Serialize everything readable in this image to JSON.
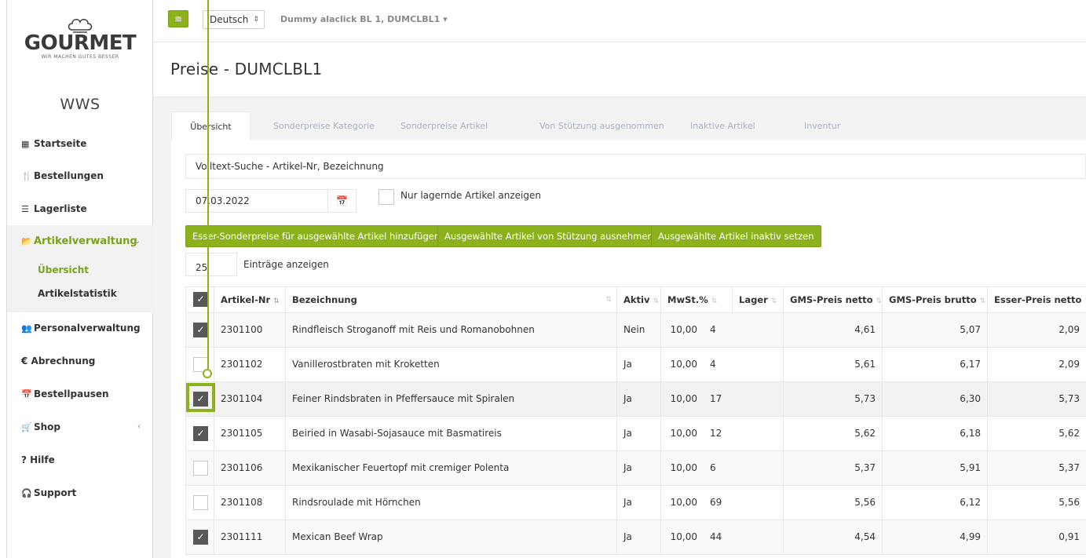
{
  "brand": {
    "logo_text": "GOURMET",
    "slogan": "WIR MACHEN GUTES BESSER",
    "app_name": "WWS"
  },
  "sidebar": {
    "items": [
      {
        "label": "Startseite",
        "icon": "th-large-icon"
      },
      {
        "label": "Bestellungen",
        "icon": "cutlery-icon"
      },
      {
        "label": "Lagerliste",
        "icon": "list-icon"
      },
      {
        "label": "Artikelverwaltung",
        "icon": "folder-open-icon"
      },
      {
        "label": "Personalverwaltung",
        "icon": "users-icon"
      },
      {
        "label": "€ Abrechnung",
        "icon": ""
      },
      {
        "label": "Bestellpausen",
        "icon": "calendar-icon"
      },
      {
        "label": "Shop",
        "icon": "cart-icon"
      },
      {
        "label": "? Hilfe",
        "icon": ""
      },
      {
        "label": "Support",
        "icon": "headset-icon"
      }
    ],
    "subitems": [
      {
        "label": "Übersicht"
      },
      {
        "label": "Artikelstatistik"
      }
    ]
  },
  "topbar": {
    "menu_icon": "≡",
    "language": "Deutsch",
    "account": "Dummy alaclick BL 1, DUMCLBL1 ▾"
  },
  "page": {
    "title": "Preise - DUMCLBL1"
  },
  "tabs": [
    {
      "label": "Übersicht"
    },
    {
      "label": "Sonderpreise Kategorie"
    },
    {
      "label": "Sonderpreise Artikel"
    },
    {
      "label": "Von Stützung ausgenommen"
    },
    {
      "label": "Inaktive Artikel"
    },
    {
      "label": "Inventur"
    }
  ],
  "filters": {
    "search_value": "Volltext-Suche - Artikel-Nr, Bezeichnung",
    "date": "07.03.2022",
    "stock_only_label": "Nur lagernde Artikel anzeigen"
  },
  "actions": {
    "add_special_prices": "Esser-Sonderpreise für ausgewählte Artikel hinzufügen",
    "exclude_subsidy": "Ausgewählte Artikel von Stützung ausnehmen",
    "set_inactive": "Ausgewählte Artikel inaktiv setzen"
  },
  "page_length": {
    "value": "25",
    "label": "Einträge anzeigen"
  },
  "table": {
    "columns": [
      "Artikel-Nr",
      "Bezeichnung",
      "Aktiv",
      "MwSt.%",
      "Lager",
      "GMS-Preis netto",
      "GMS-Preis brutto",
      "Esser-Preis netto"
    ],
    "rows": [
      {
        "checked": true,
        "nr": "2301100",
        "name": "Rindfleisch Stroganoff mit Reis und Romanobohnen",
        "aktiv": "Nein",
        "mwst": "10,00",
        "lager": "4",
        "gms_netto": "4,61",
        "gms_brutto": "5,07",
        "esser_netto": "2,09"
      },
      {
        "checked": false,
        "nr": "2301102",
        "name": "Vanillerostbraten mit Kroketten",
        "aktiv": "Ja",
        "mwst": "10,00",
        "lager": "4",
        "gms_netto": "5,61",
        "gms_brutto": "6,17",
        "esser_netto": "2,09"
      },
      {
        "checked": true,
        "nr": "2301104",
        "name": "Feiner Rindsbraten in Pfeffersauce mit Spiralen",
        "aktiv": "Ja",
        "mwst": "10,00",
        "lager": "17",
        "gms_netto": "5,73",
        "gms_brutto": "6,30",
        "esser_netto": "5,73"
      },
      {
        "checked": true,
        "nr": "2301105",
        "name": "Beiried in Wasabi-Sojasauce mit Basmatireis",
        "aktiv": "Ja",
        "mwst": "10,00",
        "lager": "12",
        "gms_netto": "5,62",
        "gms_brutto": "6,18",
        "esser_netto": "5,62"
      },
      {
        "checked": false,
        "nr": "2301106",
        "name": "Mexikanischer Feuertopf mit cremiger Polenta",
        "aktiv": "Ja",
        "mwst": "10,00",
        "lager": "6",
        "gms_netto": "5,37",
        "gms_brutto": "5,91",
        "esser_netto": "5,37"
      },
      {
        "checked": false,
        "nr": "2301108",
        "name": "Rindsroulade mit Hörnchen",
        "aktiv": "Ja",
        "mwst": "10,00",
        "lager": "69",
        "gms_netto": "5,56",
        "gms_brutto": "6,12",
        "esser_netto": "5,56"
      },
      {
        "checked": true,
        "nr": "2301111",
        "name": "Mexican Beef Wrap",
        "aktiv": "Ja",
        "mwst": "10,00",
        "lager": "44",
        "gms_netto": "4,54",
        "gms_brutto": "4,99",
        "esser_netto": "0,91"
      }
    ]
  },
  "colors": {
    "accent": "#8bb21b",
    "accent_text": "#7aa21a",
    "checkbox_on": "#585858"
  }
}
